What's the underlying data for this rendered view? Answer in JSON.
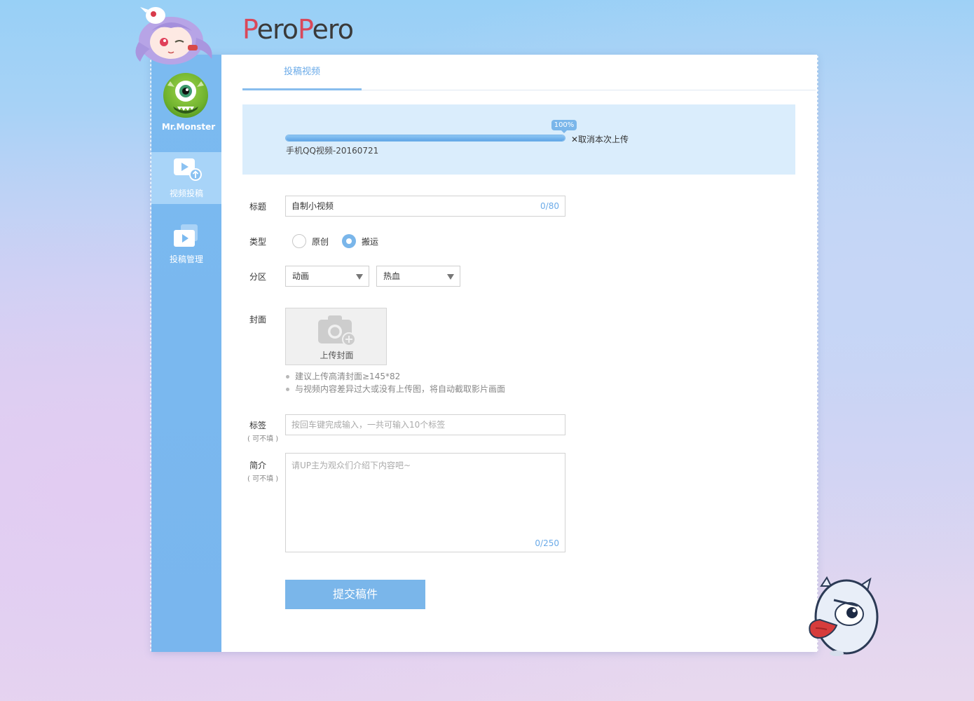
{
  "brand": {
    "logo_text_p1": "P",
    "logo_text_1": "ero",
    "logo_text_p2": "P",
    "logo_text_2": "ero"
  },
  "user": {
    "name": "Mr.Monster"
  },
  "sidebar": {
    "items": [
      {
        "label": "视频投稿",
        "icon": "video-upload-icon",
        "active": true
      },
      {
        "label": "投稿管理",
        "icon": "video-manage-icon",
        "active": false
      }
    ]
  },
  "tabs": [
    {
      "label": "投稿视频",
      "active": true
    }
  ],
  "upload": {
    "progress_label": "100%",
    "progress": 1.0,
    "cancel_label": "✕取消本次上传",
    "file_name": "手机QQ视频-20160721"
  },
  "form": {
    "title": {
      "label": "标题",
      "value": "自制小视频",
      "counter": "0/80"
    },
    "type": {
      "label": "类型",
      "options": [
        {
          "label": "原创",
          "checked": false
        },
        {
          "label": "搬运",
          "checked": true
        }
      ]
    },
    "category": {
      "label": "分区",
      "primary": "动画",
      "secondary": "热血"
    },
    "cover": {
      "label": "封面",
      "upload_label": "上传封面",
      "hints": [
        "建议上传高清封面≥145*82",
        "与视频内容差异过大或没有上传图，将自动截取影片画面"
      ]
    },
    "tags": {
      "label": "标签",
      "optional": "( 可不填 )",
      "placeholder": "按回车键完成输入，一共可输入10个标签"
    },
    "intro": {
      "label": "简介",
      "optional": "( 可不填 )",
      "placeholder": "请UP主为观众们介绍下内容吧~",
      "counter": "0/250"
    },
    "submit_label": "提交稿件"
  },
  "colors": {
    "accent": "#7ab6ea",
    "sidebar": "#79b6ee",
    "upload_bg": "#daedfc"
  }
}
